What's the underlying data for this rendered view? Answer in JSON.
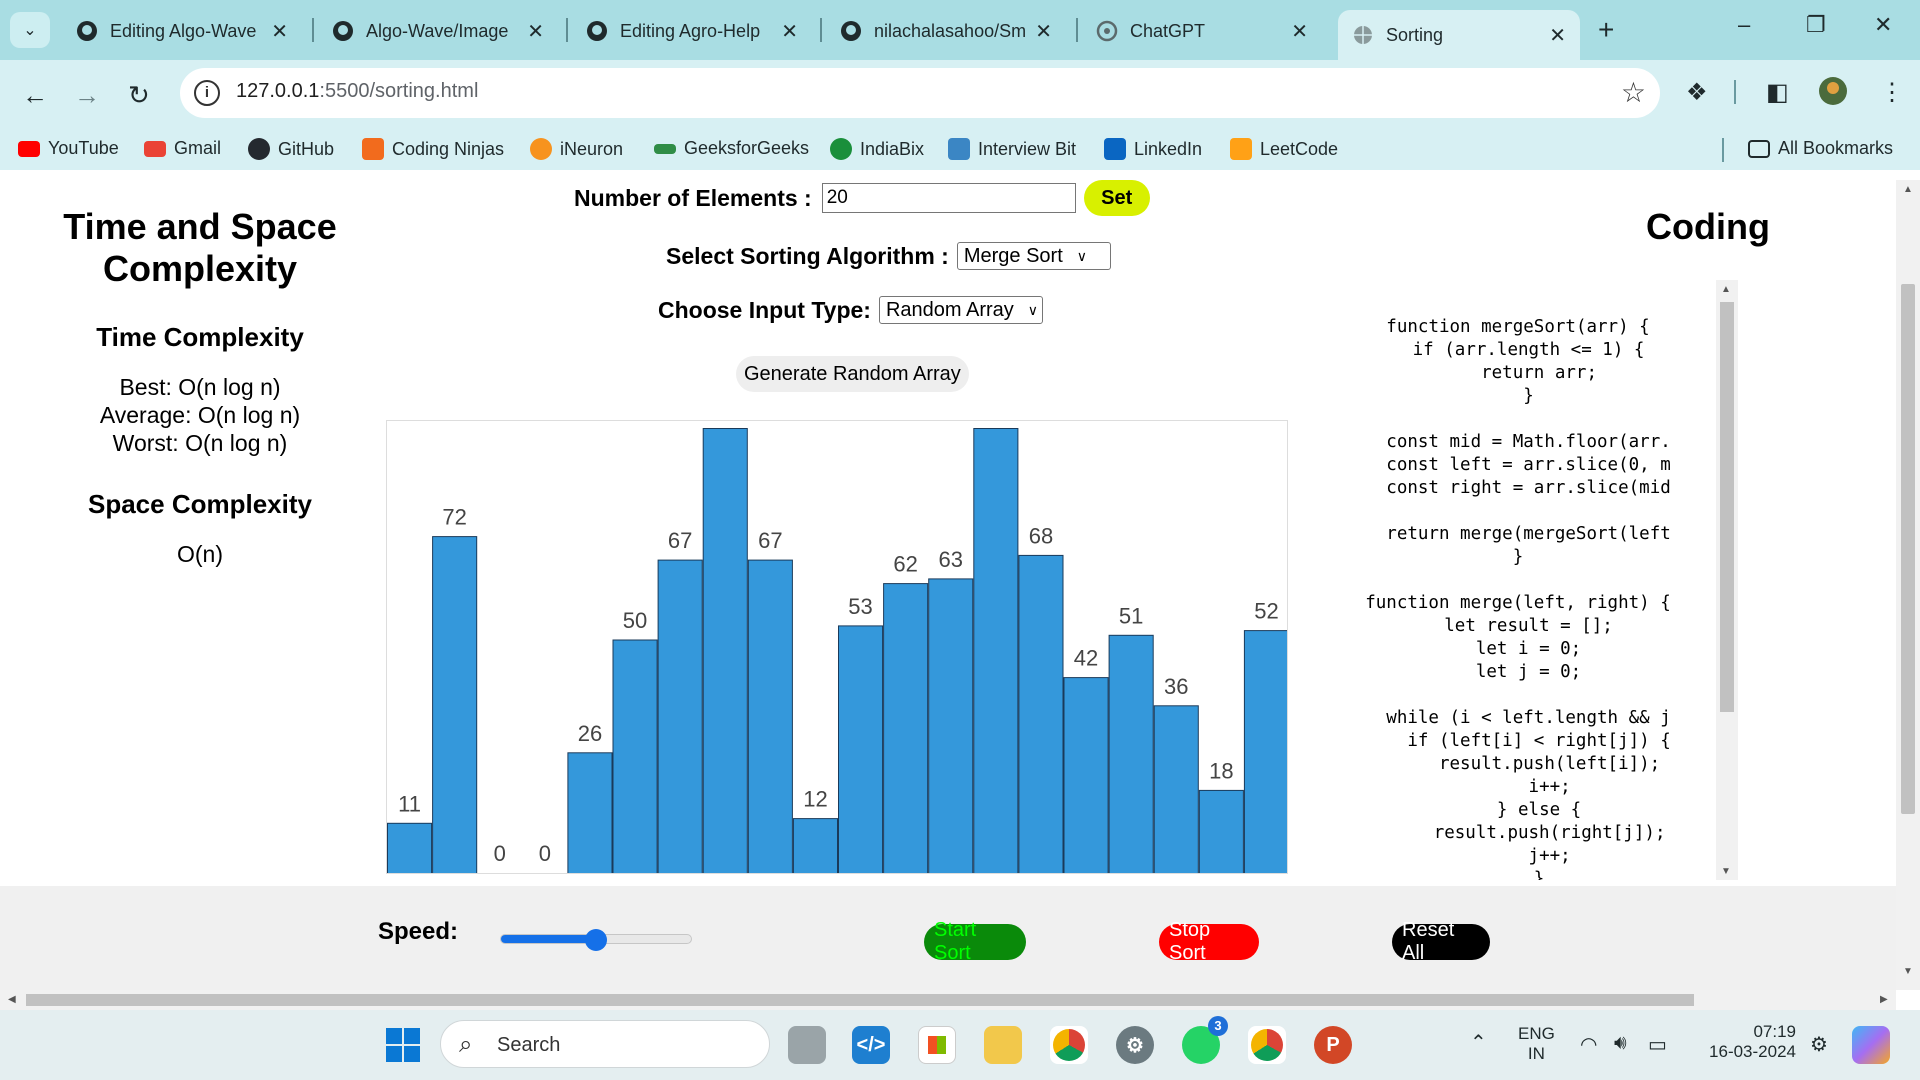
{
  "browser": {
    "tabs": [
      {
        "title": "Editing Algo-Wave",
        "icon": "github-icon"
      },
      {
        "title": "Algo-Wave/Image",
        "icon": "github-icon"
      },
      {
        "title": "Editing Agro-Help",
        "icon": "github-icon"
      },
      {
        "title": "nilachalasahoo/Sm",
        "icon": "github-icon"
      },
      {
        "title": "ChatGPT",
        "icon": "chatgpt-icon"
      },
      {
        "title": "Sorting",
        "icon": "globe-icon",
        "active": true
      }
    ],
    "url_host": "127.0.0.1",
    "url_rest": ":5500/sorting.html",
    "bookmarks": [
      {
        "label": "YouTube",
        "color": "#ff0000"
      },
      {
        "label": "Gmail",
        "color": "#ea4335"
      },
      {
        "label": "GitHub",
        "color": "#24292f"
      },
      {
        "label": "Coding Ninjas",
        "color": "#f26b1d"
      },
      {
        "label": "iNeuron",
        "color": "#f7931e"
      },
      {
        "label": "GeeksforGeeks",
        "color": "#2f8d46"
      },
      {
        "label": "IndiaBix",
        "color": "#1a8f3b"
      },
      {
        "label": "Interview Bit",
        "color": "#3b86c4"
      },
      {
        "label": "LinkedIn",
        "color": "#0a66c2"
      },
      {
        "label": "LeetCode",
        "color": "#ffa116"
      }
    ],
    "all_bookmarks": "All Bookmarks"
  },
  "left_panel": {
    "title_line1": "Time and Space",
    "title_line2": "Complexity",
    "time_heading": "Time Complexity",
    "best": "Best: O(n log n)",
    "average": "Average: O(n log n)",
    "worst": "Worst: O(n log n)",
    "space_heading": "Space Complexity",
    "space_value": "O(n)"
  },
  "controls": {
    "elements_label": "Number of Elements :",
    "elements_value": "20",
    "set_label": "Set",
    "algo_label": "Select Sorting Algorithm :",
    "algo_selected": "Merge Sort",
    "input_label": "Choose Input Type:",
    "input_selected": "Random Array",
    "generate_label": "Generate Random Array"
  },
  "chart_data": {
    "type": "bar",
    "values": [
      11,
      72,
      0,
      0,
      26,
      50,
      67,
      95,
      67,
      12,
      53,
      62,
      63,
      95,
      68,
      42,
      51,
      36,
      18,
      52
    ],
    "ylim": [
      0,
      100
    ],
    "bar_color": "#3498db",
    "bar_stroke": "#1a3a5a"
  },
  "coding": {
    "title": "Coding",
    "code_lines": [
      "function mergeSort(arr) {",
      "  if (arr.length <= 1) {",
      "    return arr;",
      "  }",
      "",
      "  const mid = Math.floor(arr.",
      "  const left = arr.slice(0, m",
      "  const right = arr.slice(mid",
      "",
      "  return merge(mergeSort(left",
      "}",
      "",
      "function merge(left, right) {",
      "  let result = [];",
      "  let i = 0;",
      "  let j = 0;",
      "",
      "  while (i < left.length && j",
      "    if (left[i] < right[j]) {",
      "      result.push(left[i]);",
      "      i++;",
      "    } else {",
      "      result.push(right[j]);",
      "      j++;",
      "    }"
    ]
  },
  "bottom": {
    "speed_label": "Speed:",
    "speed_fraction": 0.5,
    "start_label": "Start Sort",
    "stop_label": "Stop Sort",
    "reset_label": "Reset All"
  },
  "taskbar": {
    "search_text": "Search",
    "lang_top": "ENG",
    "lang_bottom": "IN",
    "time": "07:19",
    "date": "16-03-2024",
    "whatsapp_badge": "3"
  }
}
